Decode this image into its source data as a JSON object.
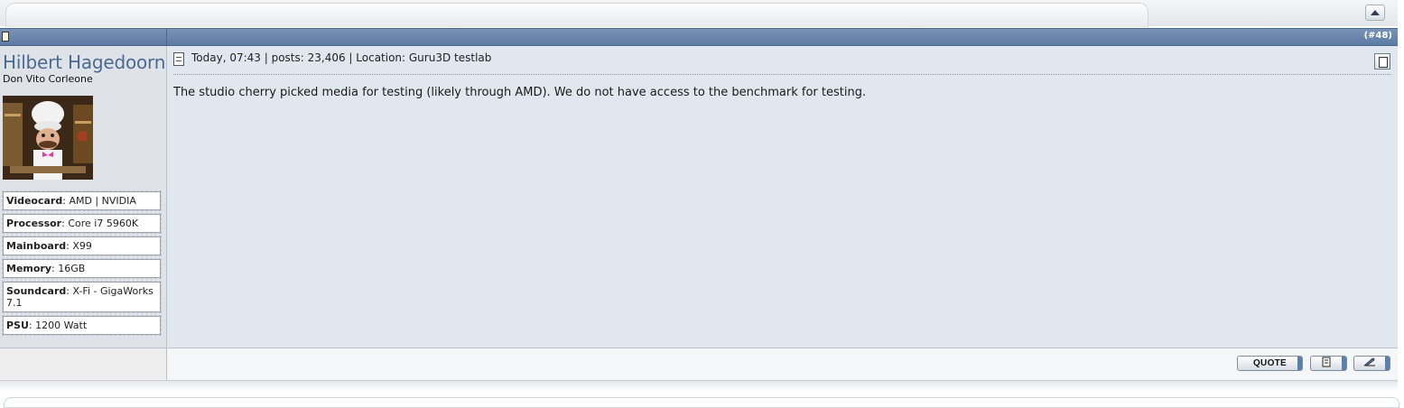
{
  "post": {
    "number": "(#48)",
    "meta": "Today, 07:43 | posts: 23,406 | Location: Guru3D testlab",
    "message": "The studio cherry picked media for testing (likely through AMD). We do not have access to the benchmark for testing."
  },
  "user": {
    "name": "Hilbert Hagedoorn",
    "title": "Don Vito Corleone",
    "specs": [
      {
        "label": "Videocard",
        "value": "AMD | NVIDIA"
      },
      {
        "label": "Processor",
        "value": "Core i7 5960K"
      },
      {
        "label": "Mainboard",
        "value": "X99"
      },
      {
        "label": "Memory",
        "value": "16GB"
      },
      {
        "label": "Soundcard",
        "value": "X-Fi - GigaWorks 7.1"
      },
      {
        "label": "PSU",
        "value": "1200 Watt"
      }
    ]
  },
  "buttons": {
    "quote": "QUOTE",
    "multiquote_icon": "multiquote-icon",
    "reply_icon": "quick-reply-icon"
  },
  "colors": {
    "header_bar": "#6a87ad",
    "content_bg": "#e1e7ef",
    "username": "#4a6a94"
  }
}
